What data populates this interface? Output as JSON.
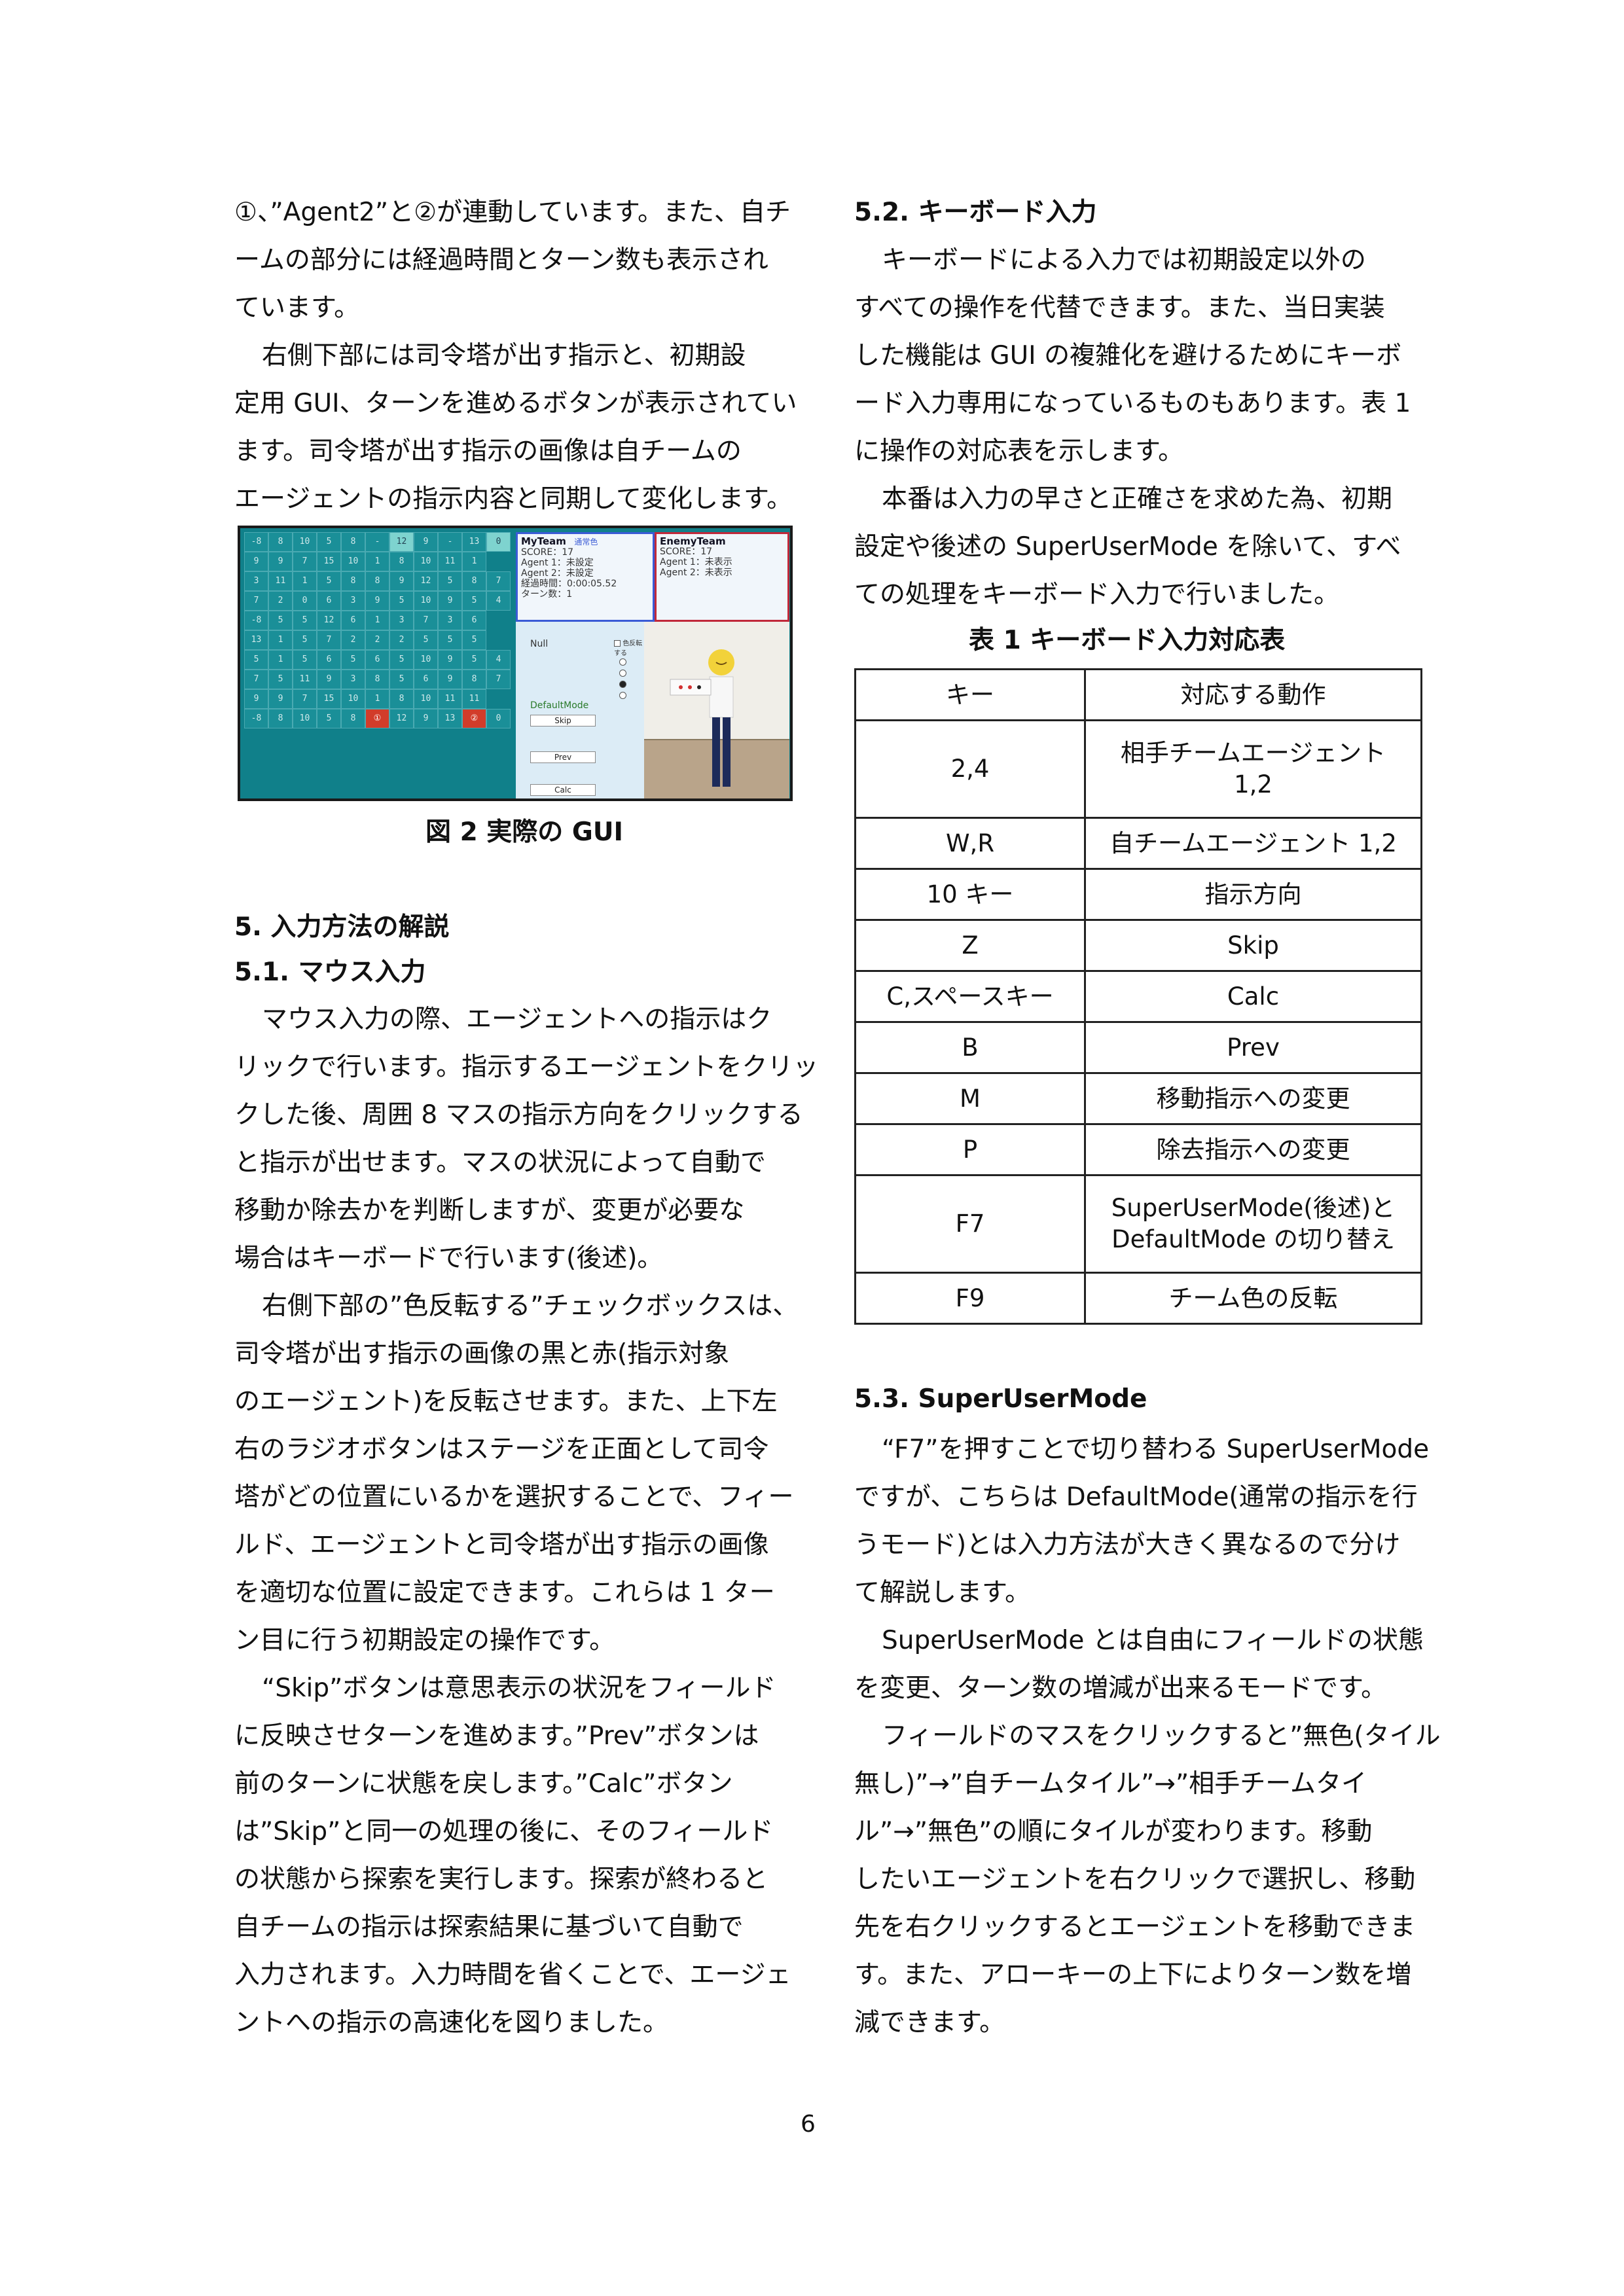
{
  "left_column": {
    "para1": [
      "①、”Agent2”と②が連動しています。また、自チ",
      "ームの部分には経過時間とターン数も表示され",
      "ています。"
    ],
    "para2": [
      "右側下部には司令塔が出す指示と、初期設",
      "定用 GUI、ターンを進めるボタンが表示されてい",
      "ます。司令塔が出す指示の画像は自チームの",
      "エージェントの指示内容と同期して変化します。"
    ],
    "figure_caption": "図 2  実際の GUI",
    "section5_heading": "5.    入力方法の解説",
    "section51_heading": "5.1.    マウス入力",
    "para3": [
      "マウス入力の際、エージェントへの指示はク",
      "リックで行います。指示するエージェントをクリッ",
      "クした後、周囲 8 マスの指示方向をクリックする",
      "と指示が出せます。マスの状況によって自動で",
      "移動か除去かを判断しますが、変更が必要な",
      "場合はキーボードで行います(後述)。"
    ],
    "para4": [
      "右側下部の”色反転する”チェックボックスは、",
      "司令塔が出す指示の画像の黒と赤(指示対象",
      "のエージェント)を反転させます。また、上下左",
      "右のラジオボタンはステージを正面として司令",
      "塔がどの位置にいるかを選択することで、フィー",
      "ルド、エージェントと司令塔が出す指示の画像",
      "を適切な位置に設定できます。これらは 1 ター",
      "ン目に行う初期設定の操作です。"
    ],
    "para5": [
      "“Skip”ボタンは意思表示の状況をフィールド",
      "に反映させターンを進めます。”Prev”ボタンは",
      "前のターンに状態を戻します。”Calc”ボタン",
      "は”Skip”と同一の処理の後に、そのフィールド",
      "の状態から探索を実行します。探索が終わると",
      "自チームの指示は探索結果に基づいて自動で",
      "入力されます。入力時間を省くことで、エージェ",
      "ントへの指示の高速化を図りました。"
    ]
  },
  "right_column": {
    "section52_heading": "5.2.    キーボード入力",
    "para1": [
      "キーボードによる入力では初期設定以外の",
      "すべての操作を代替できます。また、当日実装",
      "した機能は GUI の複雑化を避けるためにキーボ",
      "ード入力専用になっているものもあります。表  1",
      "に操作の対応表を示します。"
    ],
    "para2": [
      "本番は入力の早さと正確さを求めた為、初期",
      "設定や後述の  SuperUserMode  を除いて、すべ",
      "ての処理をキーボード入力で行いました。"
    ],
    "table_caption": "表 1  キーボード入力対応表",
    "table": {
      "headers": [
        "キー",
        "対応する動作"
      ],
      "rows": [
        {
          "key": "2,4",
          "action": [
            "相手チームエージェント",
            "1,2"
          ]
        },
        {
          "key": "W,R",
          "action": [
            "自チームエージェント 1,2"
          ]
        },
        {
          "key": "10 キー",
          "action": [
            "指示方向"
          ]
        },
        {
          "key": "Z",
          "action": [
            "Skip"
          ]
        },
        {
          "key": "C,スペースキー",
          "action": [
            "Calc"
          ]
        },
        {
          "key": "B",
          "action": [
            "Prev"
          ]
        },
        {
          "key": "M",
          "action": [
            "移動指示への変更"
          ]
        },
        {
          "key": "P",
          "action": [
            "除去指示への変更"
          ]
        },
        {
          "key": "F7",
          "action": [
            "SuperUserMode(後述)と",
            "DefaultMode の切り替え"
          ]
        },
        {
          "key": "F9",
          "action": [
            "チーム色の反転"
          ]
        }
      ]
    },
    "section53_heading": "5.3.    SuperUserMode",
    "para3": [
      "“F7”を押すことで切り替わる SuperUserMode",
      "ですが、こちらは  DefaultMode(通常の指示を行",
      "うモード)とは入力方法が大きく異なるので分け",
      "て解説します。"
    ],
    "para4": [
      "SuperUserMode  とは自由にフィールドの状態",
      "を変更、ターン数の増減が出来るモードです。"
    ],
    "para5": [
      "フィールドのマスをクリックすると”無色(タイル",
      "無し)”→”自チームタイル”→”相手チームタイ",
      "ル”→”無色”の順にタイルが変わります。移動",
      "したいエージェントを右クリックで選択し、移動",
      "先を右クリックするとエージェントを移動できま",
      "す。また、アローキーの上下によりターン数を増",
      "減できます。"
    ]
  },
  "figure": {
    "grid_rows": [
      [
        "-8",
        "8",
        "10",
        "5",
        "8",
        "-",
        "12",
        "9",
        "-",
        "13",
        "0"
      ],
      [
        "9",
        "9",
        "7",
        "15",
        "10",
        "1",
        "8",
        "10",
        "11",
        "1"
      ],
      [
        "3",
        "11",
        "1",
        "5",
        "8",
        "8",
        "9",
        "12",
        "5",
        "8",
        "7"
      ],
      [
        "7",
        "2",
        "0",
        "6",
        "3",
        "9",
        "5",
        "10",
        "9",
        "5",
        "4"
      ],
      [
        "-8",
        "5",
        "5",
        "12",
        "6",
        "1",
        "3",
        "7",
        "3",
        "6"
      ],
      [
        "13",
        "1",
        "5",
        "7",
        "2",
        "2",
        "2",
        "5",
        "5",
        "5"
      ],
      [
        "5",
        "1",
        "5",
        "6",
        "5",
        "6",
        "5",
        "10",
        "9",
        "5",
        "4"
      ],
      [
        "7",
        "5",
        "11",
        "9",
        "3",
        "8",
        "5",
        "6",
        "9",
        "8",
        "7"
      ],
      [
        "9",
        "9",
        "7",
        "15",
        "10",
        "1",
        "8",
        "10",
        "11",
        "11"
      ],
      [
        "-8",
        "8",
        "10",
        "5",
        "8",
        "①",
        "12",
        "9",
        "13",
        "②",
        "0"
      ]
    ],
    "myteam": {
      "title": "MyTeam",
      "tag": "通常色",
      "lines": [
        "SCORE：17",
        "Agent 1：未設定",
        "Agent 2：未設定",
        "経過時間：0:00:05.52",
        "ターン数：1"
      ]
    },
    "enemyteam": {
      "title": "EnemyTeam",
      "lines": [
        "SCORE：17",
        "Agent 1：未表示",
        "Agent 2：未表示"
      ]
    },
    "null_label": "Null",
    "checkbox_label": "色反転する",
    "mode_label": "DefaultMode",
    "buttons": [
      "Skip",
      "Prev",
      "Calc"
    ],
    "colors": {
      "field": "#1a8f98",
      "myteam_border": "#3a5bd6",
      "enemy_border": "#c0283a"
    }
  },
  "page_number": "6"
}
